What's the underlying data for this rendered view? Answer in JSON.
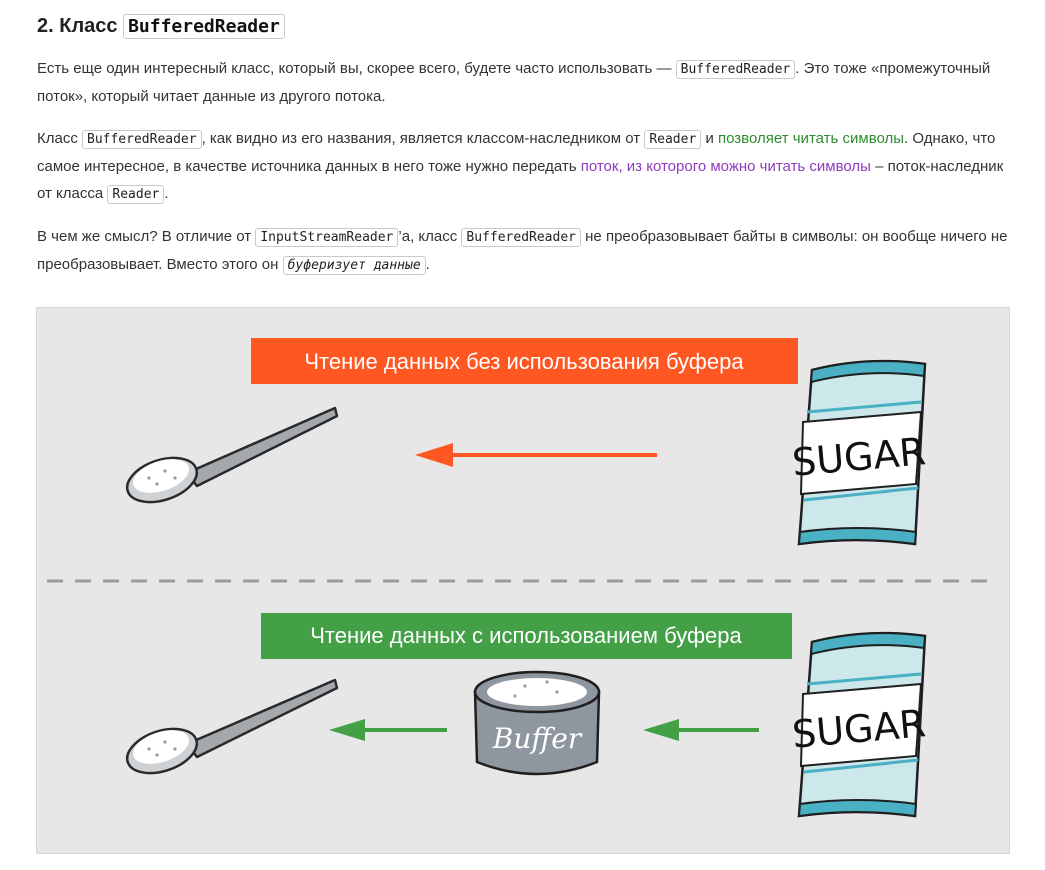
{
  "heading": {
    "prefix": "2. Класс ",
    "code": "BufferedReader"
  },
  "p1": {
    "t1": "Есть еще один интересный класс, который вы, скорее всего, будете часто использовать — ",
    "c1": "BufferedReader",
    "t2": ". Это тоже «промежуточный поток», который читает данные из другого потока."
  },
  "p2": {
    "t1": "Класс ",
    "c1": "BufferedReader",
    "t2": ", как видно из его названия, является классом-наследником от ",
    "c2": "Reader",
    "t3": " и ",
    "g1": "позволяет читать символы",
    "t4": ". Однако, что самое интересное, в качестве источника данных в него тоже нужно передать ",
    "v1": "поток, из которого можно читать символы",
    "t5": " – поток-наследник от класса ",
    "c3": "Reader",
    "t6": "."
  },
  "p3": {
    "t1": "В чем же смысл? В отличие от ",
    "c1": "InputStreamReader",
    "t2": "’а, класс ",
    "c2": "BufferedReader",
    "t3": " не преобразовывает байты в символы: он вообще ничего не преобразовывает. Вместо этого он ",
    "c3": "буферизует данные",
    "t4": "."
  },
  "figure": {
    "banner_top": "Чтение данных без использования буфера",
    "banner_bottom": "Чтение данных с использованием буфера",
    "sugar_label": "SUGAR",
    "buffer_label": "Buffer",
    "colors": {
      "background": "#e7e7e7",
      "orange": "#ff5722",
      "green": "#43a047",
      "bag_light": "#cde8ea",
      "bag_stripe": "#4ab0c4",
      "bowl": "#8e979f",
      "spoon": "#a3a8ad"
    }
  }
}
